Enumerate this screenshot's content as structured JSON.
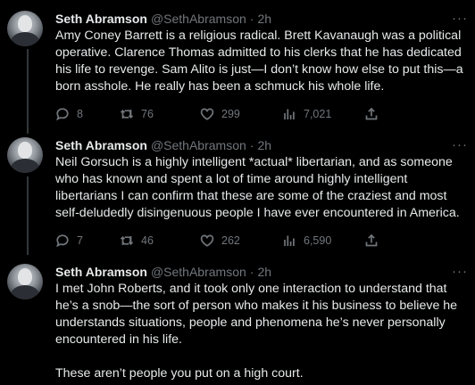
{
  "tweets": [
    {
      "author_name": "Seth Abramson",
      "handle": "@SethAbramson",
      "separator": "·",
      "time": "2h",
      "text": "Amy Coney Barrett is a religious radical. Brett Kavanaugh was a political operative. Clarence Thomas admitted to his clerks that he has dedicated his life to revenge. Sam Alito is just—I don’t know how else to put this—a born asshole. He really has been a schmuck his whole life.",
      "replies": "8",
      "retweets": "76",
      "likes": "299",
      "views": "7,021"
    },
    {
      "author_name": "Seth Abramson",
      "handle": "@SethAbramson",
      "separator": "·",
      "time": "2h",
      "text": "Neil Gorsuch is a highly intelligent *actual* libertarian, and as someone who has known and spent a lot of time around highly intelligent libertarians I can confirm that these are some of the craziest and most self-deludedly disingenuous people I have ever encountered in America.",
      "replies": "7",
      "retweets": "46",
      "likes": "262",
      "views": "6,590"
    },
    {
      "author_name": "Seth Abramson",
      "handle": "@SethAbramson",
      "separator": "·",
      "time": "2h",
      "text": "I met John Roberts, and it took only one interaction to understand that he’s a snob—the sort of person who makes it his business to believe he understands situations, people and phenomena he’s never personally encountered in his life.\n\nThese aren’t people you put on a high court."
    }
  ],
  "icons": {
    "more": "more-horizontal-icon",
    "reply": "reply-bubble-icon",
    "retweet": "retweet-icon",
    "like": "heart-icon",
    "views": "views-bar-chart-icon",
    "share": "share-upload-icon"
  },
  "colors": {
    "background": "#000000",
    "text_primary": "#e7e9ea",
    "text_secondary": "#71767b",
    "thread_line": "#333639"
  }
}
